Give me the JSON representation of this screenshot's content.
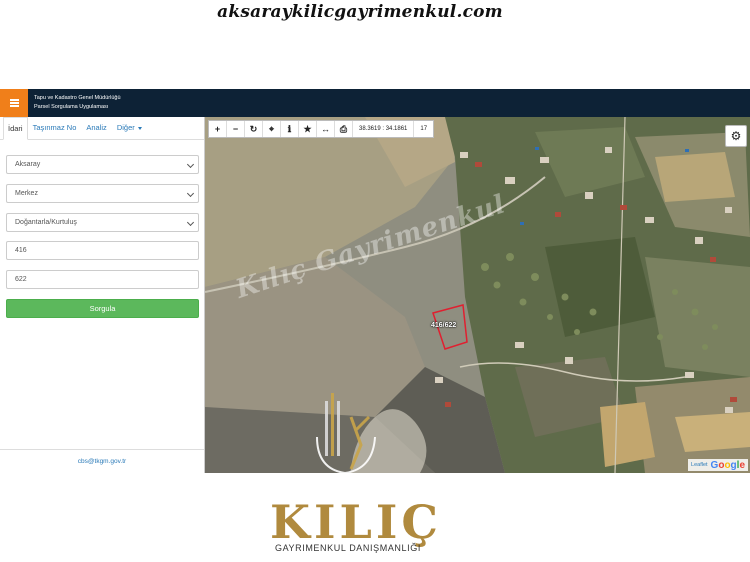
{
  "watermark": {
    "top_text": "aksaraykilicgayrimenkul.com",
    "map_text": "Kılıç Gayrimenkul"
  },
  "header": {
    "title_line1": "Tapu ve Kadastro Genel Müdürlüğü",
    "title_line2": "Parsel Sorgulama Uygulaması",
    "menu_icon": "hamburger-icon",
    "accent_color": "#f07f1a",
    "bg_color": "#0d2236"
  },
  "sidebar": {
    "tabs": [
      {
        "label": "İdari",
        "active": true
      },
      {
        "label": "Taşınmaz No",
        "active": false
      },
      {
        "label": "Analiz",
        "active": false
      },
      {
        "label": "Diğer",
        "active": false
      }
    ],
    "fields": {
      "province": "Aksaray",
      "district": "Merkez",
      "neighborhood": "Doğantarla/Kurtuluş",
      "block": "416",
      "parcel": "622"
    },
    "submit_label": "Sorgula",
    "footer_email": "cbs@tkgm.gov.tr"
  },
  "map": {
    "toolbar_icons": [
      "plus-icon",
      "minus-icon",
      "refresh-icon",
      "locate-icon",
      "info-icon",
      "star-icon",
      "measure-icon",
      "print-icon"
    ],
    "coordinates": "38.3619 : 34.1861",
    "zoom_level": "17",
    "parcel_label": "416/622",
    "attribution_leaflet": "Leaflet",
    "attribution_google": "Google",
    "parcel_color": "#e02030"
  },
  "brand": {
    "name": "KILIÇ",
    "subtitle": "GAYRIMENKUL DANIŞMANLIĞI",
    "color": "#b08a3e"
  }
}
